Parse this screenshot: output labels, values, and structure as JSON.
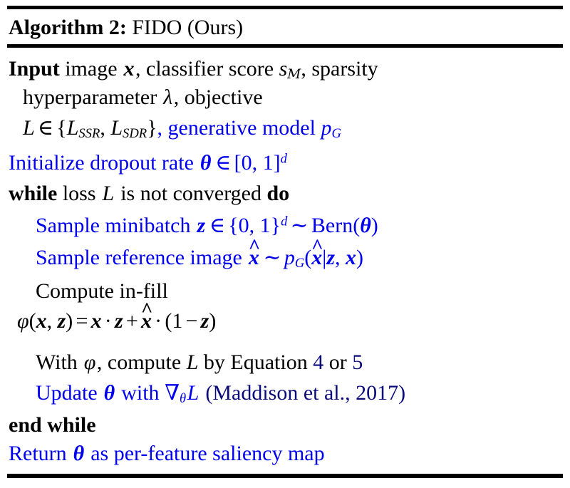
{
  "algorithm": {
    "label": "Algorithm 2:",
    "name": "FIDO (Ours)",
    "colors": {
      "text": "#000000",
      "highlight": "#0000EE",
      "hyperlink": "#0A0A7A",
      "background": "#FFFFFF"
    }
  },
  "lines": {
    "input_1": {
      "keyword": "Input",
      "t1": "image",
      "v_x": "x",
      "t2": ", classifier score",
      "v_s": "s",
      "sub_s": "M",
      "t3": ", sparsity"
    },
    "input_2": {
      "t1": "hyperparameter",
      "v_lambda": "λ",
      "t2": ", objective"
    },
    "input_3": {
      "v_L": "L",
      "rel": "∈",
      "open": "{",
      "v_L1": "L",
      "sub_L1": "SSR",
      "comma": ",",
      "v_L2": "L",
      "sub_L2": "SDR",
      "close": "}",
      "t_gen": ", generative model",
      "v_p": "p",
      "sub_p": "G"
    },
    "initialize": {
      "t1": "Initialize dropout rate",
      "v_theta": "θ",
      "rel": "∈",
      "interval": "[0, 1]",
      "sup": "d"
    },
    "while": {
      "kw_while": "while",
      "t1": "loss",
      "v_L": "L",
      "t2": "is not converged",
      "kw_do": "do"
    },
    "sample_minibatch": {
      "t1": "Sample minibatch",
      "v_z": "z",
      "rel": "∈",
      "set": "{0, 1}",
      "sup": "d",
      "dist": "∼",
      "fn": "Bern",
      "open": "(",
      "arg_theta": "θ",
      "close": ")"
    },
    "sample_reference": {
      "t1": "Sample reference image",
      "v_xhat": "x",
      "hat": "^",
      "dist": "∼",
      "v_p": "p",
      "sub_p": "G",
      "open": "(",
      "arg_xhat": "x",
      "bar": "|",
      "arg_z": "z",
      "comma": ",",
      "arg_x": "x",
      "close": ")"
    },
    "compute_infill": {
      "t1": "Compute in-fill"
    },
    "infill_equation": {
      "phi": "φ",
      "open": "(",
      "arg_x": "x",
      "comma": ",",
      "arg_z": "z",
      "close": ")",
      "eq": "=",
      "v_x": "x",
      "dot1": "·",
      "v_z": "z",
      "plus": "+",
      "v_xhat": "x",
      "hat": "^",
      "dot2": "·",
      "open2": "(",
      "one": "1",
      "minus": "−",
      "v_z2": "z",
      "close2": ")"
    },
    "compute_loss": {
      "t1": "With",
      "phi": "φ",
      "t2": ", compute",
      "v_L": "L",
      "t3": "by Equation",
      "ref_1": "4",
      "t4": "or",
      "ref_2": "5"
    },
    "update": {
      "t1": "Update",
      "v_theta": "θ",
      "t2": "with",
      "grad": "∇",
      "sub_grad": "θ",
      "v_L": "L",
      "citation": "(Maddison et al., 2017)"
    },
    "end_while": {
      "kw": "end while"
    },
    "return": {
      "t1": "Return",
      "v_theta": "θ",
      "t2": "as per-feature saliency map"
    }
  }
}
